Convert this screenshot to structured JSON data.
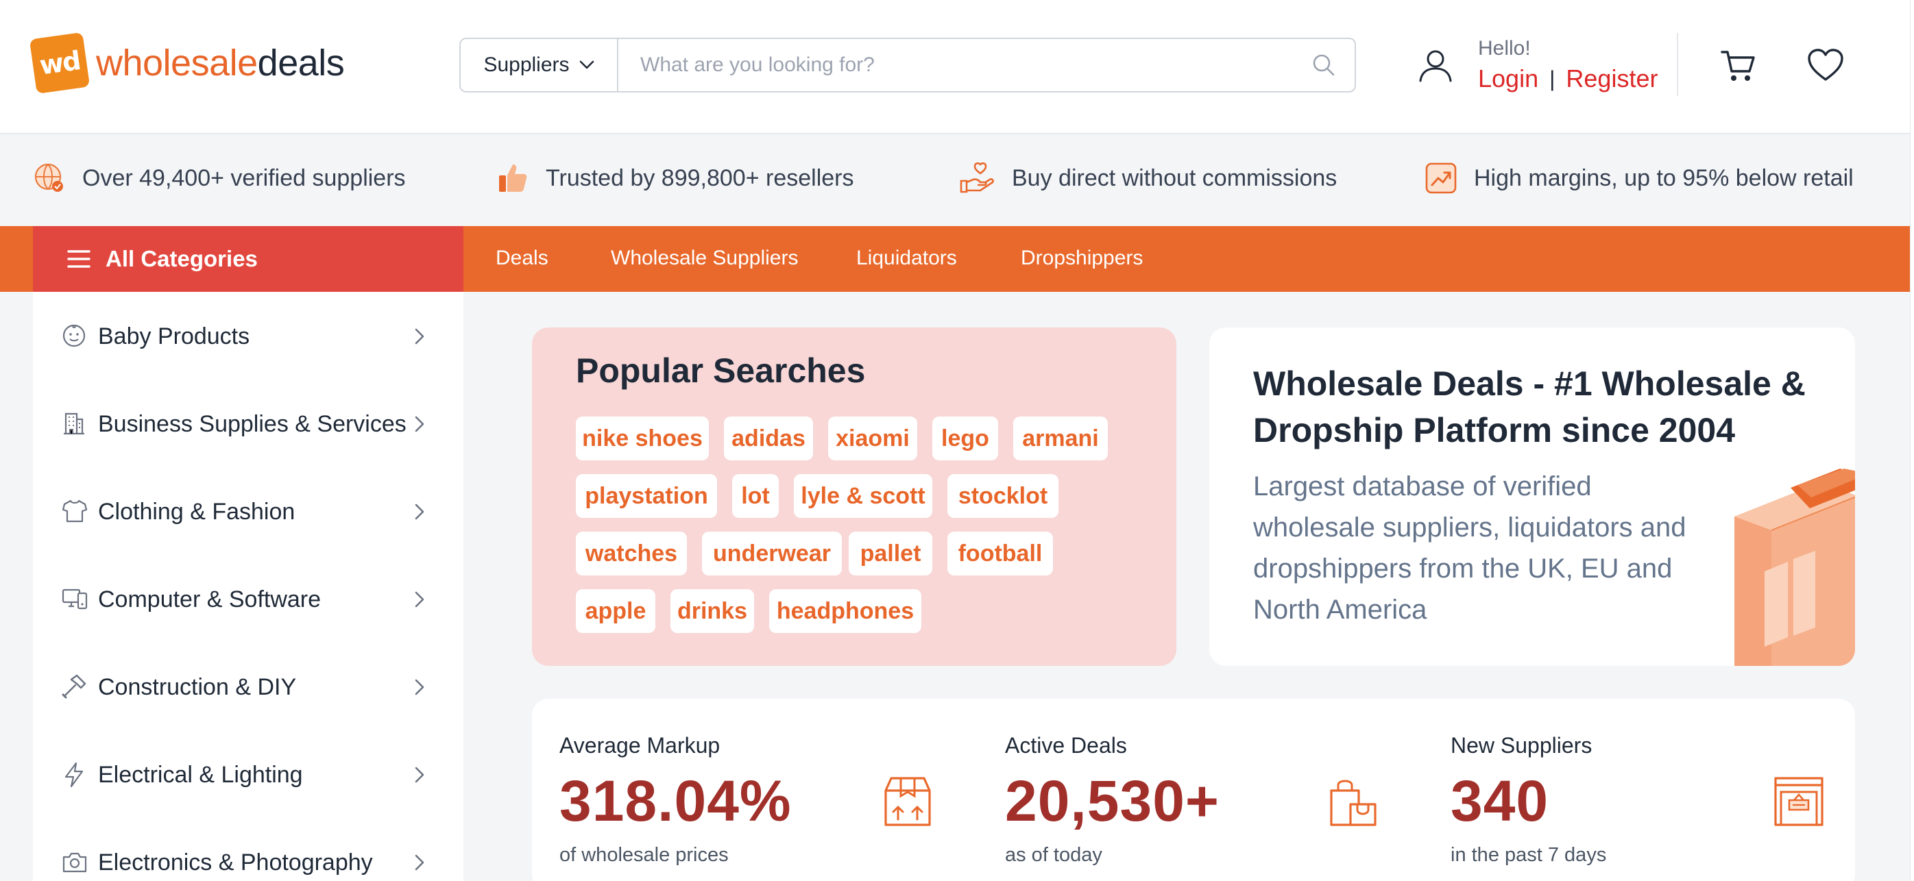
{
  "brand": {
    "logo_mark": "wd",
    "name_part1": "wholesale",
    "name_part2": "deals",
    "accent": "#e9692c",
    "red": "#e2473f"
  },
  "search": {
    "category": "Suppliers",
    "placeholder": "What are you looking for?"
  },
  "account": {
    "greeting": "Hello!",
    "login": "Login",
    "separator": "|",
    "register": "Register"
  },
  "trust": [
    {
      "icon": "globe-check-icon",
      "text": "Over 49,400+ verified suppliers"
    },
    {
      "icon": "thumbs-up-icon",
      "text": "Trusted by 899,800+ resellers"
    },
    {
      "icon": "hand-heart-icon",
      "text": "Buy direct without commissions"
    },
    {
      "icon": "trend-up-icon",
      "text": "High margins, up to 95% below retail"
    }
  ],
  "nav": {
    "all_categories": "All Categories",
    "links": [
      "Deals",
      "Wholesale Suppliers",
      "Liquidators",
      "Dropshippers"
    ]
  },
  "categories": [
    {
      "icon": "baby-icon",
      "label": "Baby Products"
    },
    {
      "icon": "building-icon",
      "label": "Business Supplies & Services"
    },
    {
      "icon": "shirt-icon",
      "label": "Clothing & Fashion"
    },
    {
      "icon": "computer-icon",
      "label": "Computer & Software"
    },
    {
      "icon": "hammer-icon",
      "label": "Construction & DIY"
    },
    {
      "icon": "lightning-icon",
      "label": "Electrical & Lighting"
    },
    {
      "icon": "camera-icon",
      "label": "Electronics & Photography"
    }
  ],
  "popular": {
    "title": "Popular Searches",
    "tags": [
      "nike shoes",
      "adidas",
      "xiaomi",
      "lego",
      "armani",
      "playstation",
      "lot",
      "lyle & scott",
      "stocklot",
      "watches",
      "underwear",
      "pallet",
      "football",
      "apple",
      "drinks",
      "headphones"
    ]
  },
  "hero": {
    "title": "Wholesale Deals - #1 Wholesale & Dropship Platform since 2004",
    "subtitle": "Largest database of verified wholesale suppliers, liquidators and dropshippers from the UK, EU and North America"
  },
  "stats": [
    {
      "label": "Average Markup",
      "value": "318.04%",
      "sub": "of wholesale prices",
      "icon": "box-arrows-icon"
    },
    {
      "label": "Active Deals",
      "value": "20,530+",
      "sub": "as of today",
      "icon": "shopping-bag-icon"
    },
    {
      "label": "New Suppliers",
      "value": "340",
      "sub": "in the past 7 days",
      "icon": "open-shop-icon"
    }
  ]
}
